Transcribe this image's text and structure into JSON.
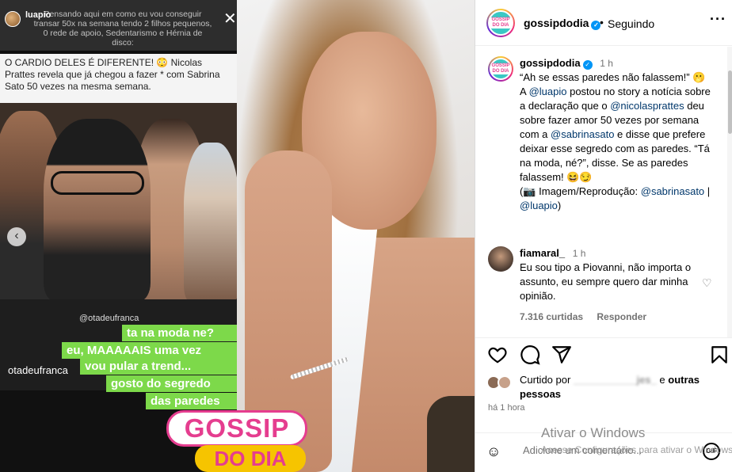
{
  "story": {
    "username": "luapio",
    "overlay_text": "Pensando aqui em como eu vou conseguir transar 50x na semana tendo 2 filhos pequenos, 0 rede de apoio, Sedentarismo e Hérnia de disco:",
    "close_glyph": "✕",
    "news_text": "O CARDIO DELES É DIFERENTE! 😳 Nicolas Prattes revela que já chegou a fazer * com Sabrina Sato 50 vezes na mesma semana.",
    "chat_handle_small": "@otadeufranca",
    "chat_handle": "otadeufranca",
    "bubbles": [
      "ta na moda ne?",
      "eu, MAAAAAIS uma vez",
      "vou pular a trend...",
      "gosto do segredo",
      "das paredes"
    ],
    "watermark_top": "GOSSIP",
    "watermark_bottom": "DO DIA",
    "carousel_prev_glyph": "‹"
  },
  "header": {
    "username": "gossipdodia",
    "dot": "•",
    "follow_status": "Seguindo",
    "more_glyph": "···",
    "logo_text": "GOSSIP DO DIA"
  },
  "caption": {
    "username": "gossipdodia",
    "time": "1 h",
    "line1": "“Ah se essas paredes não falassem!” 🫢 A ",
    "mention1": "@luapio",
    "line2": " postou no story a notícia sobre a declaração que o ",
    "mention2": "@nicolasprattes",
    "line3": " deu sobre fazer amor 50 vezes por semana com a ",
    "mention3": "@sabrinasato",
    "line4": " e disse que prefere deixar esse segredo com as paredes. “Tá na moda, né?”, disse. Se as paredes falassem! 😆😏",
    "line5": "(📷 Imagem/Reprodução: ",
    "mention4": "@sabrinasato",
    "sep": " | ",
    "mention5": "@luapio",
    "line6": ")"
  },
  "comment": {
    "username": "fiamaral_",
    "time": "1 h",
    "text": "Eu sou tipo a Piovanni, não importa o assunto, eu sempre quero dar minha opinião.",
    "likes": "7.316 curtidas",
    "reply": "Responder"
  },
  "liked_by": {
    "prefix": "Curtido por",
    "blurred_user": "___________jes_",
    "suffix": "e",
    "others": "outras pessoas"
  },
  "time_ago": "há 1 hora",
  "add_comment": {
    "placeholder": "Adicione um comentário...",
    "emoji_icon": "☺",
    "gif_label": "GIF"
  },
  "windows_watermark": {
    "title": "Ativar o Windows",
    "subtitle": "Acesse Configurações para ativar o Windows."
  },
  "colors": {
    "accent_blue": "#0095f6",
    "mention": "#00376b",
    "chat_green": "#7dd94a",
    "brand_pink": "#e53d8f",
    "brand_yellow": "#f6c400"
  }
}
